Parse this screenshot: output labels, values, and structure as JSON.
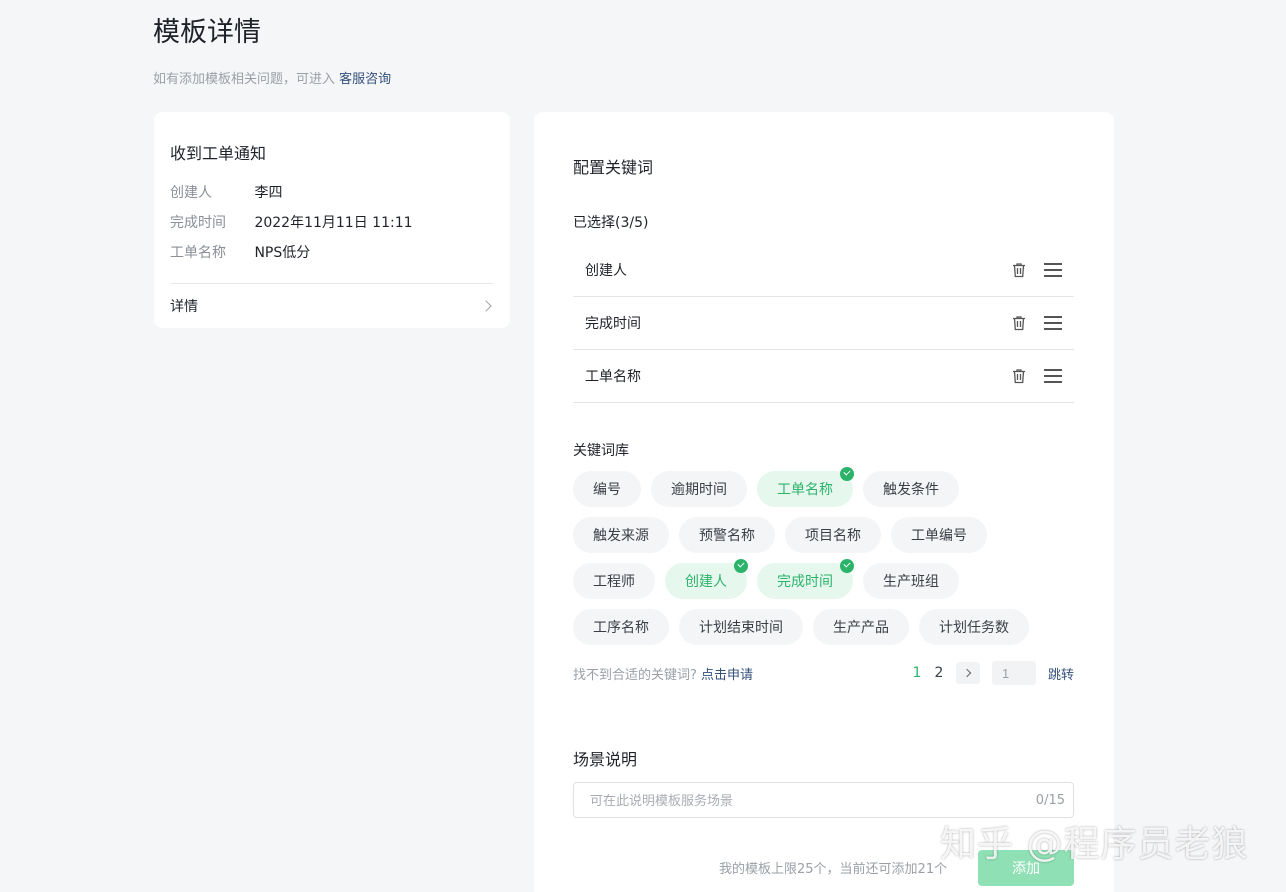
{
  "page": {
    "title": "模板详情",
    "subtitle_prefix": "如有添加模板相关问题，可进入",
    "subtitle_link": "客服咨询"
  },
  "left_card": {
    "title": "收到工单通知",
    "rows": [
      {
        "key": "创建人",
        "value": "李四"
      },
      {
        "key": "完成时间",
        "value": "2022年11月11日 11:11"
      },
      {
        "key": "工单名称",
        "value": "NPS低分"
      }
    ],
    "details_label": "详情"
  },
  "config": {
    "title": "配置关键词",
    "selected_label": "已选择(3/5)",
    "selected": [
      "创建人",
      "完成时间",
      "工单名称"
    ],
    "library_label": "关键词库",
    "tag_rows": [
      [
        {
          "label": "编号",
          "on": false
        },
        {
          "label": "逾期时间",
          "on": false
        },
        {
          "label": "工单名称",
          "on": true
        },
        {
          "label": "触发条件",
          "on": false
        }
      ],
      [
        {
          "label": "触发来源",
          "on": false
        },
        {
          "label": "预警名称",
          "on": false
        },
        {
          "label": "项目名称",
          "on": false
        },
        {
          "label": "工单编号",
          "on": false
        }
      ],
      [
        {
          "label": "工程师",
          "on": false
        },
        {
          "label": "创建人",
          "on": true
        },
        {
          "label": "完成时间",
          "on": true
        },
        {
          "label": "生产班组",
          "on": false
        }
      ],
      [
        {
          "label": "工序名称",
          "on": false
        },
        {
          "label": "计划结束时间",
          "on": false
        },
        {
          "label": "生产产品",
          "on": false
        },
        {
          "label": "计划任务数",
          "on": false
        }
      ]
    ],
    "hint_prefix": "找不到合适的关键词?",
    "hint_link": "点击申请",
    "pagination": {
      "pages": [
        "1",
        "2"
      ],
      "current": "1",
      "jump_value": "1",
      "jump_label": "跳转"
    }
  },
  "scene": {
    "title": "场景说明",
    "placeholder": "可在此说明模板服务场景",
    "counter": "0/15"
  },
  "footer": {
    "limit_text": "我的模板上限25个，当前还可添加21个",
    "add_label": "添加"
  },
  "watermark": "知乎 @程序员老狼",
  "colors": {
    "accent": "#2db36c",
    "link": "#34507a",
    "add_button": "#8fe0b5"
  }
}
